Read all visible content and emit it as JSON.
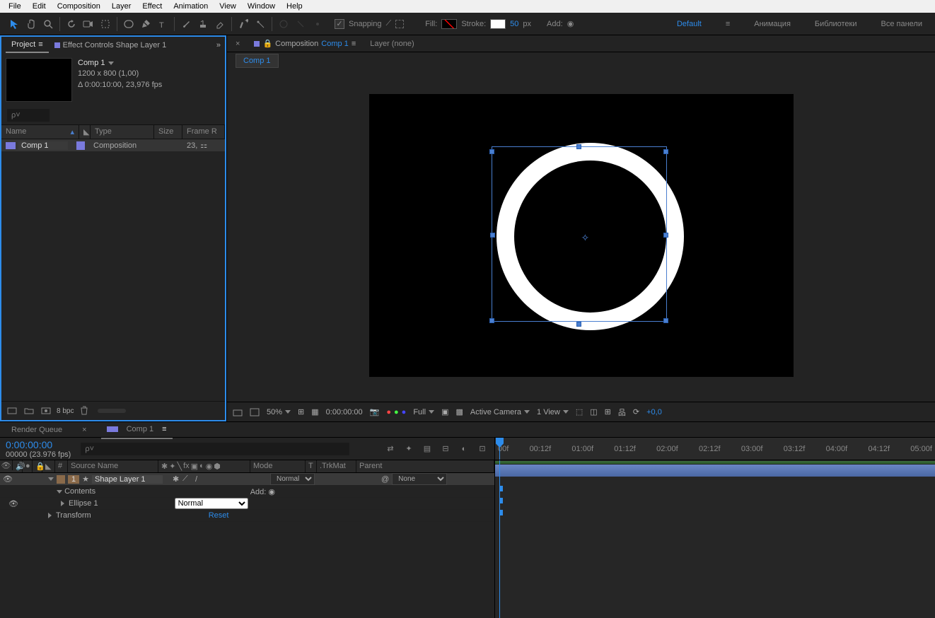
{
  "menu": [
    "File",
    "Edit",
    "Composition",
    "Layer",
    "Effect",
    "Animation",
    "View",
    "Window",
    "Help"
  ],
  "toolbar": {
    "snapping": "Snapping",
    "fill": "Fill:",
    "stroke": "Stroke:",
    "stroke_val": "50",
    "stroke_unit": "px",
    "add": "Add:"
  },
  "workspace": {
    "default": "Default",
    "m1": "Анимация",
    "m2": "Библиотеки",
    "m3": "Все панели"
  },
  "project": {
    "tab1": "Project",
    "tab2": "Effect Controls Shape Layer 1",
    "comp_name": "Comp 1",
    "dims": "1200 x 800 (1,00)",
    "dur": "Δ 0:00:10:00, 23,976 fps",
    "search_ph": "ρ˅",
    "cols": {
      "name": "Name",
      "type": "Type",
      "size": "Size",
      "frame": "Frame R"
    },
    "row": {
      "name": "Comp 1",
      "type": "Composition",
      "fr": "23,"
    },
    "bpc": "8 bpc"
  },
  "viewer": {
    "comp_tab_prefix": "Composition",
    "comp_tab_link": "Comp 1",
    "layer_tab": "Layer (none)",
    "subtab": "Comp 1",
    "footer": {
      "zoom": "50%",
      "time": "0:00:00:00",
      "res": "Full",
      "camera": "Active Camera",
      "view": "1 View",
      "exp": "+0,0"
    }
  },
  "timeline": {
    "tabs": {
      "rq": "Render Queue",
      "comp": "Comp 1"
    },
    "time": "0:00:00:00",
    "sub": "00000 (23.976 fps)",
    "cols": {
      "num": "#",
      "src": "Source Name",
      "mode": "Mode",
      "t": "T",
      "trk": ".TrkMat",
      "parent": "Parent"
    },
    "layer": {
      "num": "1",
      "name": "Shape Layer 1",
      "mode": "Normal",
      "mat": "None"
    },
    "contents": "Contents",
    "add": "Add:",
    "ellipse": "Ellipse 1",
    "ell_mode": "Normal",
    "transform": "Transform",
    "reset": "Reset",
    "marks": [
      "00f",
      "00:12f",
      "01:00f",
      "01:12f",
      "02:00f",
      "02:12f",
      "03:00f",
      "03:12f",
      "04:00f",
      "04:12f",
      "05:00f"
    ]
  }
}
